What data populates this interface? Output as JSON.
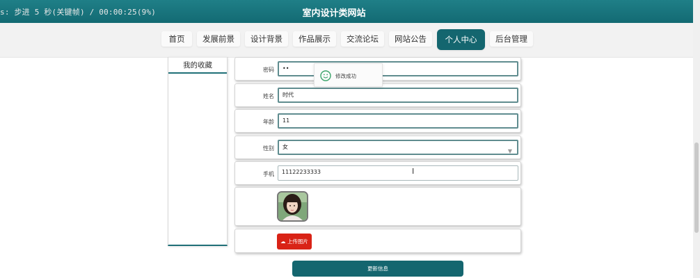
{
  "recording_overlay": "s: 步进 5 秒(关键帧) / 00:00:25(9%)",
  "header": {
    "title": "室内设计类网站"
  },
  "nav": {
    "items": [
      {
        "label": "首页"
      },
      {
        "label": "发展前景"
      },
      {
        "label": "设计背景"
      },
      {
        "label": "作品展示"
      },
      {
        "label": "交流论坛"
      },
      {
        "label": "网站公告"
      },
      {
        "label": "个人中心",
        "active": true
      },
      {
        "label": "后台管理"
      }
    ],
    "active_color": "#14666f"
  },
  "sidebar": {
    "items": [
      {
        "label": "我的收藏"
      }
    ]
  },
  "form": {
    "password_label": "密码",
    "password_value": "••",
    "name_label": "姓名",
    "name_value": "时代",
    "age_label": "年龄",
    "age_value": "11",
    "gender_label": "性别",
    "gender_value": "女",
    "phone_label": "手机",
    "phone_value": "11122233333",
    "upload_label": "上传图片",
    "submit_label": "更新信息"
  },
  "toast": {
    "text": "修改成功"
  },
  "colors": {
    "header": "#1a747c",
    "primary": "#14666f",
    "upload": "#d92316"
  }
}
